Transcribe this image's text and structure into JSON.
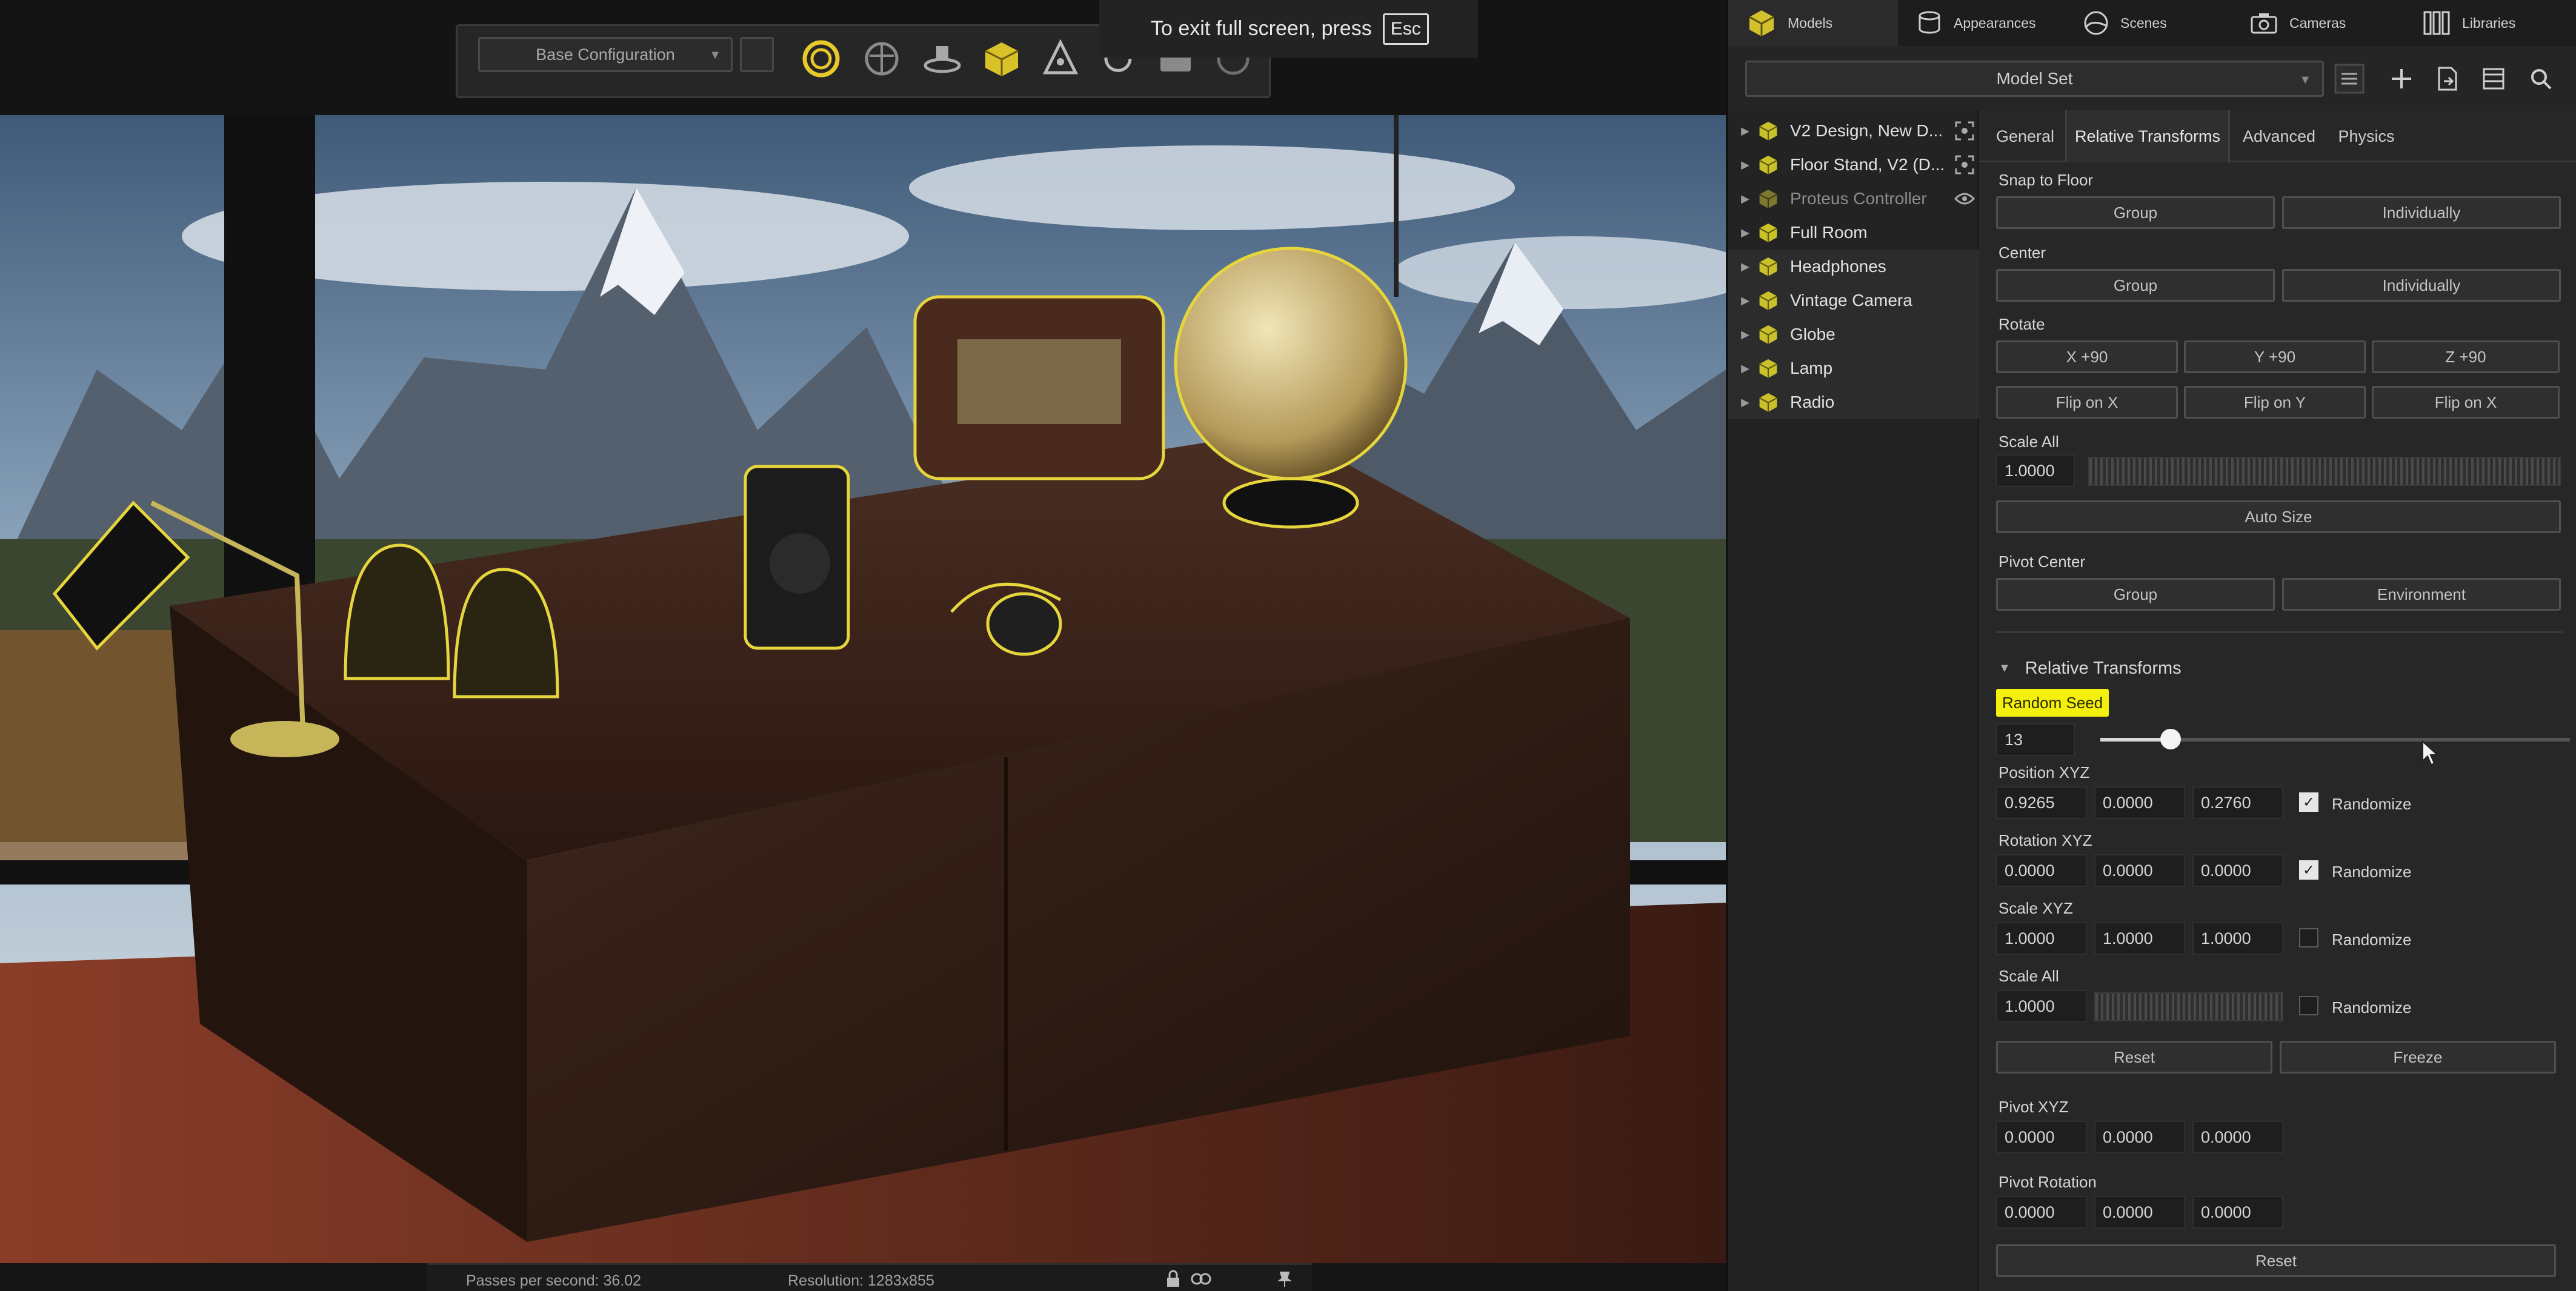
{
  "toolbar": {
    "configuration_select": "Base Configuration",
    "icons": [
      "ring-icon",
      "brain-icon",
      "turntable-icon",
      "cube-select-icon",
      "transform-gizmo-icon",
      "rotate-icon",
      "camera-icon",
      "render-icon"
    ]
  },
  "fullscreen_notice": {
    "text": "To exit full screen, press",
    "key": "Esc"
  },
  "status_bar": {
    "passes": "Passes per second: 36.02",
    "resolution": "Resolution: 1283x855"
  },
  "panel": {
    "top_tabs": [
      "Models",
      "Appearances",
      "Scenes",
      "Cameras",
      "Libraries"
    ],
    "model_set": "Model Set",
    "tree": [
      {
        "label": "V2 Design, New D...",
        "right_icon": "focus-icon"
      },
      {
        "label": "Floor Stand, V2 (D...",
        "right_icon": "focus-icon"
      },
      {
        "label": "Proteus Controller",
        "right_icon": "eye-icon",
        "dim": true
      },
      {
        "label": "Full Room"
      },
      {
        "label": "Headphones"
      },
      {
        "label": "Vintage Camera"
      },
      {
        "label": "Globe"
      },
      {
        "label": "Lamp"
      },
      {
        "label": "Radio"
      }
    ],
    "sub_tabs": [
      "General",
      "Relative Transforms",
      "Advanced",
      "Physics"
    ],
    "active_sub_tab": "Relative Transforms",
    "snap_to_floor": {
      "label": "Snap to Floor",
      "group": "Group",
      "individually": "Individually"
    },
    "center": {
      "label": "Center",
      "group": "Group",
      "individually": "Individually"
    },
    "rotate": {
      "label": "Rotate",
      "x90": "X +90",
      "y90": "Y +90",
      "z90": "Z +90",
      "flip_x": "Flip on X",
      "flip_y": "Flip on Y",
      "flip_z": "Flip on X"
    },
    "scale_all_top": {
      "label": "Scale All",
      "value": "1.0000",
      "auto_size": "Auto Size"
    },
    "pivot_center": {
      "label": "Pivot Center",
      "group": "Group",
      "environment": "Environment"
    },
    "relative_transforms": {
      "header": "Relative Transforms",
      "random_seed_label": "Random Seed",
      "random_seed_value": "13",
      "random_seed_slider": 0.15,
      "position": {
        "label": "Position XYZ",
        "x": "0.9265",
        "y": "0.0000",
        "z": "0.2760",
        "randomize": "Randomize",
        "checked": true
      },
      "rotation": {
        "label": "Rotation XYZ",
        "x": "0.0000",
        "y": "0.0000",
        "z": "0.0000",
        "randomize": "Randomize",
        "checked": true
      },
      "scale": {
        "label": "Scale XYZ",
        "x": "1.0000",
        "y": "1.0000",
        "z": "1.0000",
        "randomize": "Randomize",
        "checked": false
      },
      "scale_all": {
        "label": "Scale All",
        "value": "1.0000",
        "randomize": "Randomize",
        "checked": false
      },
      "reset": "Reset",
      "freeze": "Freeze",
      "pivot_xyz": {
        "label": "Pivot XYZ",
        "x": "0.0000",
        "y": "0.0000",
        "z": "0.0000"
      },
      "pivot_rotation": {
        "label": "Pivot Rotation",
        "x": "0.0000",
        "y": "0.0000",
        "z": "0.0000"
      },
      "reset_bottom": "Reset"
    }
  },
  "colors": {
    "highlight": "#f3f00e",
    "cube_icon": "#c9c12a",
    "panel_bg": "#252525"
  }
}
